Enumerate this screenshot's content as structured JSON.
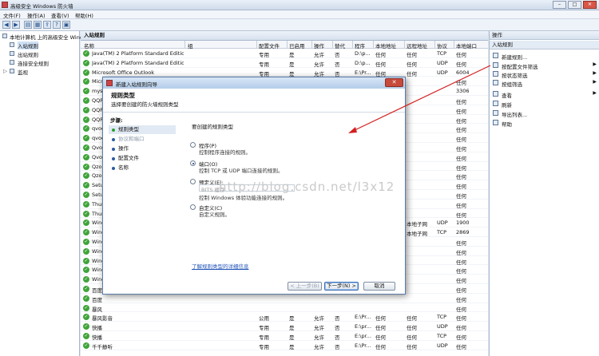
{
  "window": {
    "title": "高级安全 Windows 防火墙"
  },
  "menu": [
    "文件(F)",
    "操作(A)",
    "查看(V)",
    "帮助(H)"
  ],
  "tree": {
    "root": "本地计算机 上的高级安全 Wind",
    "items": [
      "入站规则",
      "出站规则",
      "连接安全规则",
      "监视"
    ]
  },
  "rules_pane": {
    "header": "入站规则",
    "columns": [
      "名称",
      "组",
      "配置文件",
      "已启用",
      "操作",
      "替代",
      "程序",
      "本地地址",
      "远程地址",
      "协议",
      "本地端口"
    ],
    "rows": [
      {
        "name": "Java(TM) 2 Platform Standard Edition...",
        "profile": "专用",
        "enabled": "是",
        "action": "允许",
        "override": "否",
        "program": "D:\\p...",
        "local": "任何",
        "remote": "任何",
        "protocol": "TCP",
        "port": "任何"
      },
      {
        "name": "Java(TM) 2 Platform Standard Edition...",
        "profile": "专用",
        "enabled": "是",
        "action": "允许",
        "override": "否",
        "program": "D:\\p...",
        "local": "任何",
        "remote": "任何",
        "protocol": "UDP",
        "port": "任何"
      },
      {
        "name": "Microsoft Office Outlook",
        "profile": "专用",
        "enabled": "是",
        "action": "允许",
        "override": "否",
        "program": "E:\\Pr...",
        "local": "任何",
        "remote": "任何",
        "protocol": "UDP",
        "port": "6004"
      },
      {
        "name": "Micr",
        "profile": "",
        "enabled": "",
        "action": "",
        "override": "",
        "program": "",
        "local": "",
        "remote": "",
        "protocol": "",
        "port": "任何"
      },
      {
        "name": "mys",
        "profile": "",
        "enabled": "",
        "action": "",
        "override": "",
        "program": "",
        "local": "",
        "remote": "",
        "protocol": "",
        "port": "3306"
      },
      {
        "name": "QQP",
        "profile": "",
        "enabled": "",
        "action": "",
        "override": "",
        "program": "",
        "local": "",
        "remote": "",
        "protocol": "",
        "port": "任何"
      },
      {
        "name": "QQP",
        "profile": "",
        "enabled": "",
        "action": "",
        "override": "",
        "program": "",
        "local": "",
        "remote": "",
        "protocol": "",
        "port": "任何"
      },
      {
        "name": "QQP",
        "profile": "",
        "enabled": "",
        "action": "",
        "override": "",
        "program": "",
        "local": "",
        "remote": "",
        "protocol": "",
        "port": "任何"
      },
      {
        "name": "qvod",
        "profile": "",
        "enabled": "",
        "action": "",
        "override": "",
        "program": "",
        "local": "",
        "remote": "",
        "protocol": "",
        "port": "任何"
      },
      {
        "name": "qvod",
        "profile": "",
        "enabled": "",
        "action": "",
        "override": "",
        "program": "",
        "local": "",
        "remote": "",
        "protocol": "",
        "port": "任何"
      },
      {
        "name": "Qvod",
        "profile": "",
        "enabled": "",
        "action": "",
        "override": "",
        "program": "",
        "local": "",
        "remote": "",
        "protocol": "",
        "port": "任何"
      },
      {
        "name": "Qvod",
        "profile": "",
        "enabled": "",
        "action": "",
        "override": "",
        "program": "",
        "local": "",
        "remote": "",
        "protocol": "",
        "port": "任何"
      },
      {
        "name": "Qzon",
        "profile": "",
        "enabled": "",
        "action": "",
        "override": "",
        "program": "",
        "local": "",
        "remote": "",
        "protocol": "",
        "port": "任何"
      },
      {
        "name": "Qzon",
        "profile": "",
        "enabled": "",
        "action": "",
        "override": "",
        "program": "",
        "local": "",
        "remote": "",
        "protocol": "",
        "port": "任何"
      },
      {
        "name": "Setu",
        "profile": "",
        "enabled": "",
        "action": "",
        "override": "",
        "program": "",
        "local": "",
        "remote": "",
        "protocol": "",
        "port": "任何"
      },
      {
        "name": "Setu",
        "profile": "",
        "enabled": "",
        "action": "",
        "override": "",
        "program": "",
        "local": "",
        "remote": "",
        "protocol": "",
        "port": "任何"
      },
      {
        "name": "Thun",
        "profile": "",
        "enabled": "",
        "action": "",
        "override": "",
        "program": "",
        "local": "",
        "remote": "",
        "protocol": "",
        "port": "任何"
      },
      {
        "name": "Thun",
        "profile": "",
        "enabled": "",
        "action": "",
        "override": "",
        "program": "",
        "local": "",
        "remote": "",
        "protocol": "",
        "port": "任何"
      },
      {
        "name": "Wind",
        "profile": "",
        "enabled": "",
        "action": "",
        "override": "",
        "program": "",
        "local": "",
        "remote": "本地子网",
        "protocol": "UDP",
        "port": "1900"
      },
      {
        "name": "Wind",
        "profile": "",
        "enabled": "",
        "action": "",
        "override": "",
        "program": "",
        "local": "",
        "remote": "本地子网",
        "protocol": "TCP",
        "port": "2869"
      },
      {
        "name": "Wind",
        "profile": "",
        "enabled": "",
        "action": "",
        "override": "",
        "program": "",
        "local": "",
        "remote": "",
        "protocol": "",
        "port": "任何"
      },
      {
        "name": "Wind",
        "profile": "",
        "enabled": "",
        "action": "",
        "override": "",
        "program": "",
        "local": "",
        "remote": "",
        "protocol": "",
        "port": "任何"
      },
      {
        "name": "Wind",
        "profile": "",
        "enabled": "",
        "action": "",
        "override": "",
        "program": "",
        "local": "",
        "remote": "",
        "protocol": "",
        "port": "任何"
      },
      {
        "name": "Wind",
        "profile": "",
        "enabled": "",
        "action": "",
        "override": "",
        "program": "",
        "local": "",
        "remote": "",
        "protocol": "",
        "port": "任何"
      },
      {
        "name": "Wind",
        "profile": "",
        "enabled": "",
        "action": "",
        "override": "",
        "program": "",
        "local": "",
        "remote": "",
        "protocol": "",
        "port": "任何"
      },
      {
        "name": "百度",
        "profile": "",
        "enabled": "",
        "action": "",
        "override": "",
        "program": "",
        "local": "",
        "remote": "",
        "protocol": "",
        "port": "任何"
      },
      {
        "name": "百度",
        "profile": "",
        "enabled": "",
        "action": "",
        "override": "",
        "program": "",
        "local": "",
        "remote": "",
        "protocol": "",
        "port": "任何"
      },
      {
        "name": "暴风",
        "profile": "",
        "enabled": "",
        "action": "",
        "override": "",
        "program": "",
        "local": "",
        "remote": "",
        "protocol": "",
        "port": "任何"
      },
      {
        "name": "暴风影音",
        "profile": "公用",
        "enabled": "是",
        "action": "允许",
        "override": "否",
        "program": "E:\\Pr...",
        "local": "任何",
        "remote": "任何",
        "protocol": "TCP",
        "port": "任何"
      },
      {
        "name": "快播",
        "profile": "专用",
        "enabled": "是",
        "action": "允许",
        "override": "否",
        "program": "E:\\pr...",
        "local": "任何",
        "remote": "任何",
        "protocol": "UDP",
        "port": "任何"
      },
      {
        "name": "快播",
        "profile": "专用",
        "enabled": "是",
        "action": "允许",
        "override": "否",
        "program": "E:\\pr...",
        "local": "任何",
        "remote": "任何",
        "protocol": "TCP",
        "port": "任何"
      },
      {
        "name": "千千静听",
        "profile": "专用",
        "enabled": "是",
        "action": "允许",
        "override": "否",
        "program": "E:\\Pr...",
        "local": "任何",
        "remote": "任何",
        "protocol": "UDP",
        "port": "任何"
      }
    ]
  },
  "actions_pane": {
    "header": "操作",
    "subheader": "入站规则",
    "items": [
      {
        "label": "新建规则...",
        "arrow": ""
      },
      {
        "label": "按配置文件筛选",
        "arrow": "▶"
      },
      {
        "label": "按状态筛选",
        "arrow": "▶"
      },
      {
        "label": "按组筛选",
        "arrow": "▶"
      },
      {
        "label": "查看",
        "arrow": "▶"
      },
      {
        "label": "刷新",
        "arrow": ""
      },
      {
        "label": "导出列表...",
        "arrow": ""
      },
      {
        "label": "帮助",
        "arrow": ""
      }
    ]
  },
  "wizard": {
    "title": "新建入站规则向导",
    "close": "✕",
    "heading": "规则类型",
    "subheading": "选择要创建的防火墙规则类型",
    "steps_header": "步骤:",
    "steps": [
      "规则类型",
      "协议和端口",
      "操作",
      "配置文件",
      "名称"
    ],
    "question": "要创建的规则类型",
    "options": [
      {
        "label": "程序(P)",
        "desc": "控制程序连接的规则。",
        "selected": false
      },
      {
        "label": "端口(O)",
        "desc": "控制 TCP 或 UDP 端口连接的规则。",
        "selected": true
      },
      {
        "label": "预定义(E):",
        "desc": "BITS 缓存",
        "desc2": "控制 Windows 体验功能连接的规则。",
        "selected": false
      },
      {
        "label": "自定义(C)",
        "desc": "自定义规则。",
        "selected": false
      }
    ],
    "link": "了解规则类型的详细信息",
    "buttons": {
      "back": "< 上一步(B)",
      "next": "下一步(N) >",
      "cancel": "取消"
    }
  },
  "watermark": "http://blog.csdn.net/l3x12",
  "colors": {
    "accent": "#2e6fc8",
    "ok": "#3fa43a",
    "arrow": "#d42020"
  }
}
